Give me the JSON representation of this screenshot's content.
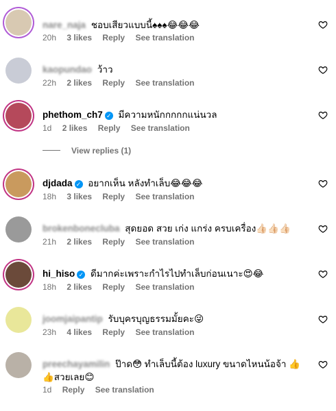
{
  "comments": [
    {
      "username": "nare_naja",
      "blurred": true,
      "verified": false,
      "text": "ชอบเสียวแบบนี้♠♠♠😂😂😂",
      "time": "20h",
      "likes": "3 likes",
      "reply": "Reply",
      "see": "See translation",
      "avatar_color": "#d8c9b2"
    },
    {
      "username": "kaopundao",
      "blurred": true,
      "verified": false,
      "text": "ว้าว",
      "time": "22h",
      "likes": "2 likes",
      "reply": "Reply",
      "see": "See translation",
      "avatar_color": "#c9ccd6"
    },
    {
      "username": "phethom_ch7",
      "blurred": false,
      "verified": true,
      "text": "มีความหนักกกกกแน่นวล",
      "time": "1d",
      "likes": "2 likes",
      "reply": "Reply",
      "see": "See translation",
      "avatar_color": "#b5495b"
    },
    {
      "username": "djdada",
      "blurred": false,
      "verified": true,
      "text": "อยากเห็น หลังทำเล็บ😂😂😂",
      "time": "18h",
      "likes": "3 likes",
      "reply": "Reply",
      "see": "See translation",
      "avatar_color": "#c99a5e"
    },
    {
      "username": "brokenbonecluba",
      "blurred": true,
      "verified": false,
      "text": "สุดยอด สวย เก่ง แกร่ง ครบเครื่อง👍🏻👍🏻👍🏻",
      "time": "21h",
      "likes": "2 likes",
      "reply": "Reply",
      "see": "See translation",
      "avatar_color": "#9a9a9a"
    },
    {
      "username": "hi_hiso",
      "blurred": false,
      "verified": true,
      "text": "ดีมากค่ะเพราะกำไรไปทำเล็บก่อนเนาะ😍😂",
      "time": "18h",
      "likes": "2 likes",
      "reply": "Reply",
      "see": "See translation",
      "avatar_color": "#6b4a3a"
    },
    {
      "username": "joomjaipantip",
      "blurred": true,
      "verified": false,
      "text": "รับบุครบุญธรรมมั้ยคะ😜",
      "time": "23h",
      "likes": "4 likes",
      "reply": "Reply",
      "see": "See translation",
      "avatar_color": "#e9e79a"
    },
    {
      "username": "preechayamilin",
      "blurred": true,
      "verified": false,
      "text": "ป๊าด😳 ทำเล็บนี้ต้อง luxury ขนาดไหนน้อจ้า 👍",
      "text2": "👍สวยเลย😊",
      "time": "1d",
      "likes": "",
      "reply": "Reply",
      "see": "See translation",
      "avatar_color": "#b9b1a7"
    }
  ],
  "view_replies": "View replies (1)",
  "icons": {
    "heart": "heart-outline-icon",
    "verified": "verified-badge-icon"
  }
}
